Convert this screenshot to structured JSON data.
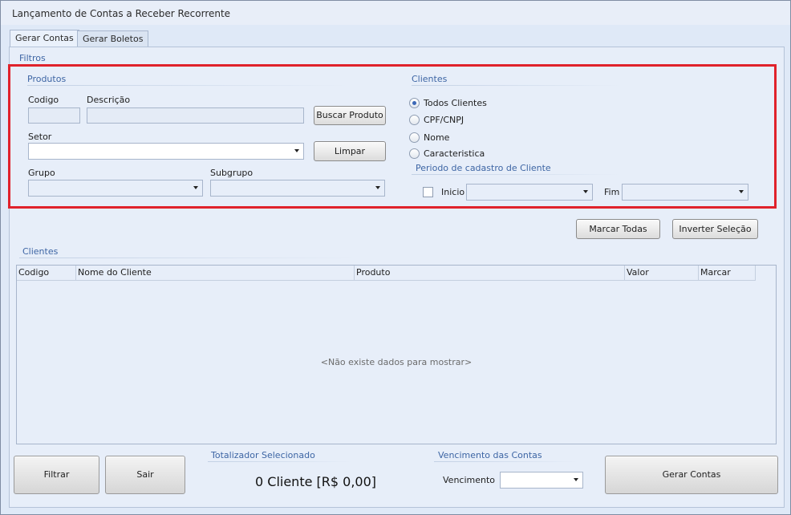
{
  "window": {
    "title": "Lançamento de Contas a Receber Recorrente"
  },
  "tabs": [
    {
      "label": "Gerar Contas",
      "active": true
    },
    {
      "label": "Gerar Boletos",
      "active": false
    }
  ],
  "filtros": {
    "caption": "Filtros",
    "produtos": {
      "caption": "Produtos",
      "codigo_label": "Codigo",
      "codigo_value": "",
      "descricao_label": "Descrição",
      "descricao_value": "",
      "buscar_button": "Buscar Produto",
      "setor_label": "Setor",
      "setor_value": "",
      "limpar_button": "Limpar",
      "grupo_label": "Grupo",
      "grupo_value": "",
      "subgrupo_label": "Subgrupo",
      "subgrupo_value": ""
    },
    "clientes": {
      "caption": "Clientes",
      "options": [
        {
          "label": "Todos Clientes",
          "checked": true
        },
        {
          "label": "CPF/CNPJ",
          "checked": false
        },
        {
          "label": "Nome",
          "checked": false
        },
        {
          "label": "Caracteristica",
          "checked": false
        }
      ],
      "periodo_caption": "Periodo de cadastro de Cliente",
      "inicio_label": "Inicio",
      "inicio_checked": false,
      "inicio_value": "",
      "fim_label": "Fim",
      "fim_value": ""
    }
  },
  "actions": {
    "marcar_todas": "Marcar Todas",
    "inverter_selecao": "Inverter Seleção"
  },
  "clientes_grid": {
    "caption": "Clientes",
    "columns": [
      "Codigo",
      "Nome do Cliente",
      "Produto",
      "Valor",
      "Marcar"
    ],
    "rows": [],
    "empty_message": "<Não existe dados para mostrar>"
  },
  "footer": {
    "filtrar_button": "Filtrar",
    "sair_button": "Sair",
    "totalizador_caption": "Totalizador Selecionado",
    "totalizador_value": "0 Cliente [R$ 0,00]",
    "vencimento_caption": "Vencimento das Contas",
    "vencimento_label": "Vencimento",
    "vencimento_value": "",
    "gerar_button": "Gerar Contas"
  },
  "colors": {
    "background": "#dfe9f7",
    "group_caption": "#3d65a4",
    "highlight_border": "#e0222b",
    "radio_checked": "#3b68b7"
  },
  "icons": {
    "dropdown": "chevron-down-icon",
    "radio": "radio-button",
    "checkbox": "checkbox"
  }
}
